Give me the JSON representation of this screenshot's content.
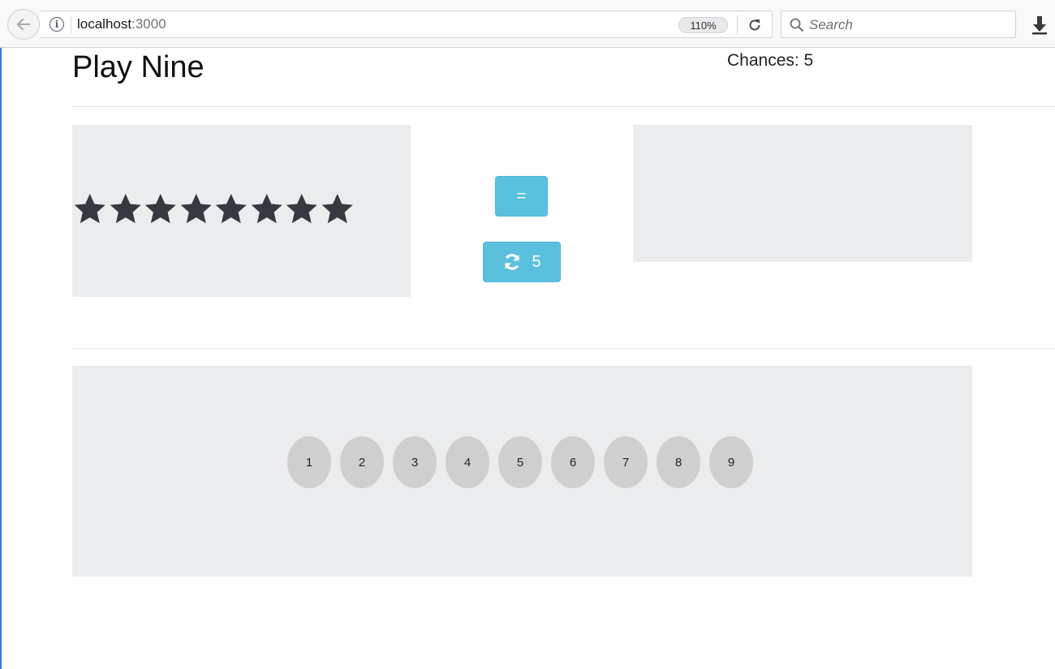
{
  "browser": {
    "url_host": "localhost",
    "url_port": ":3000",
    "zoom": "110%",
    "search_placeholder": "Search"
  },
  "game": {
    "title": "Play Nine",
    "chances_label": "Chances: 5",
    "star_count": 8,
    "equals_label": "=",
    "redraws_label": "5",
    "numbers": [
      "1",
      "2",
      "3",
      "4",
      "5",
      "6",
      "7",
      "8",
      "9"
    ]
  },
  "colors": {
    "button_info": "#5bc0de",
    "panel_bg": "#ebeced",
    "number_bg": "#cfcfcf",
    "star": "#343a40"
  }
}
